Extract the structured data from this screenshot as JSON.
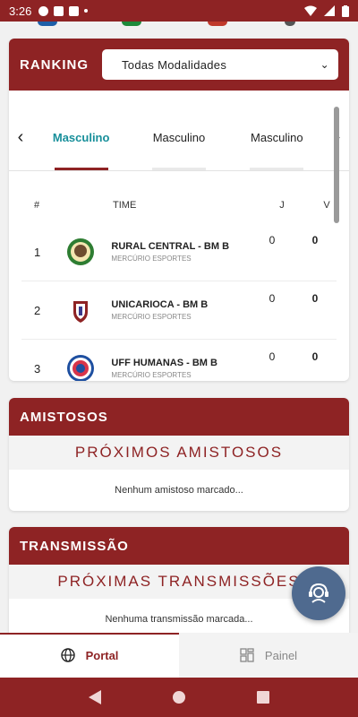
{
  "status_bar": {
    "time": "3:26"
  },
  "ranking": {
    "title": "RANKING",
    "select_value": "Todas Modalidades",
    "tabs": [
      {
        "label": "Masculino"
      },
      {
        "label": "Masculino"
      },
      {
        "label": "Masculino"
      }
    ],
    "columns": {
      "pos": "#",
      "team": "TIME",
      "j": "J",
      "v": "V"
    },
    "rows": [
      {
        "pos": "1",
        "name": "RURAL CENTRAL - BM B",
        "org": "MERCÚRIO ESPORTES",
        "j": "0",
        "v": "0"
      },
      {
        "pos": "2",
        "name": "UNICARIOCA - BM B",
        "org": "MERCÚRIO ESPORTES",
        "j": "0",
        "v": "0"
      },
      {
        "pos": "3",
        "name": "UFF HUMANAS - BM B",
        "org": "MERCÚRIO ESPORTES",
        "j": "0",
        "v": "0"
      }
    ]
  },
  "amistosos": {
    "title": "AMISTOSOS",
    "subtitle": "PRÓXIMOS AMISTOSOS",
    "empty": "Nenhum amistoso marcado..."
  },
  "transmissao": {
    "title": "TRANSMISSÃO",
    "subtitle": "PRÓXIMAS TRANSMISSÕES",
    "empty": "Nenhuma transmissão marcada..."
  },
  "bottom_nav": {
    "portal": "Portal",
    "painel": "Painel"
  },
  "colors": {
    "brand": "#8e2324",
    "accent": "#178f9a",
    "fab": "#4f6a8f"
  }
}
